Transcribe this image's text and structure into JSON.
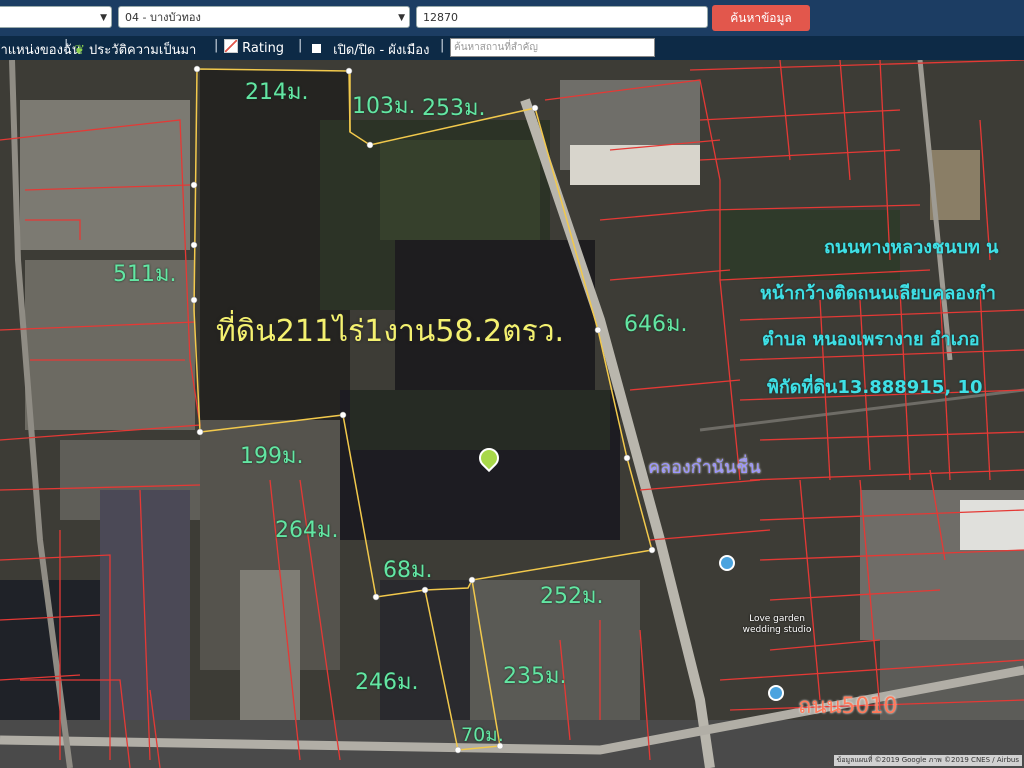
{
  "toolbar": {
    "province_value": "",
    "district_value": "04 - บางบัวทอง",
    "postcode_value": "12870",
    "search_button": "ค้นหาข้อมูล"
  },
  "menu": {
    "item1": "ตำแหน่งของฉัน",
    "item2": "ประวัติความเป็นมา",
    "item3": "Rating",
    "item4": "เปิด/ปิด - ผังเมือง",
    "place_search_placeholder": "ค้นหาสถานที่สำคัญ"
  },
  "map": {
    "distances": [
      "214ม.",
      "103ม.",
      "253ม.",
      "511ม.",
      "646ม.",
      "199ม.",
      "264ม.",
      "68ม.",
      "252ม.",
      "246ม.",
      "235ม.",
      "70ม."
    ],
    "area_label": "ที่ดิน211ไร่1งาน58.2ตรว.",
    "info_lines": [
      "ถนนทางหลวงชนบท  น",
      "หน้ากว้างติดถนนเลียบคลองกำ",
      "ตำบล  หนองเพรางาย  อำเภอ",
      "พิกัดที่ดิน13.888915,  10"
    ],
    "canal_label": "คลองกำนันชื่น",
    "road_label": "ถนน5010",
    "poi_1": "Love garden wedding studio",
    "attribution": "ข้อมูลแผนที่ ©2019 Google ภาพ ©2019 CNES / Airbus"
  },
  "colors": {
    "topbar": "#1c3d63",
    "menubar": "#0d2a46",
    "search_button": "#e2574c",
    "parcel_lines": "#e53935",
    "boundary": "#f2c94c",
    "distance_text": "#63e6a3",
    "area_text": "#f4f170",
    "info_text": "#3fe0e6"
  }
}
